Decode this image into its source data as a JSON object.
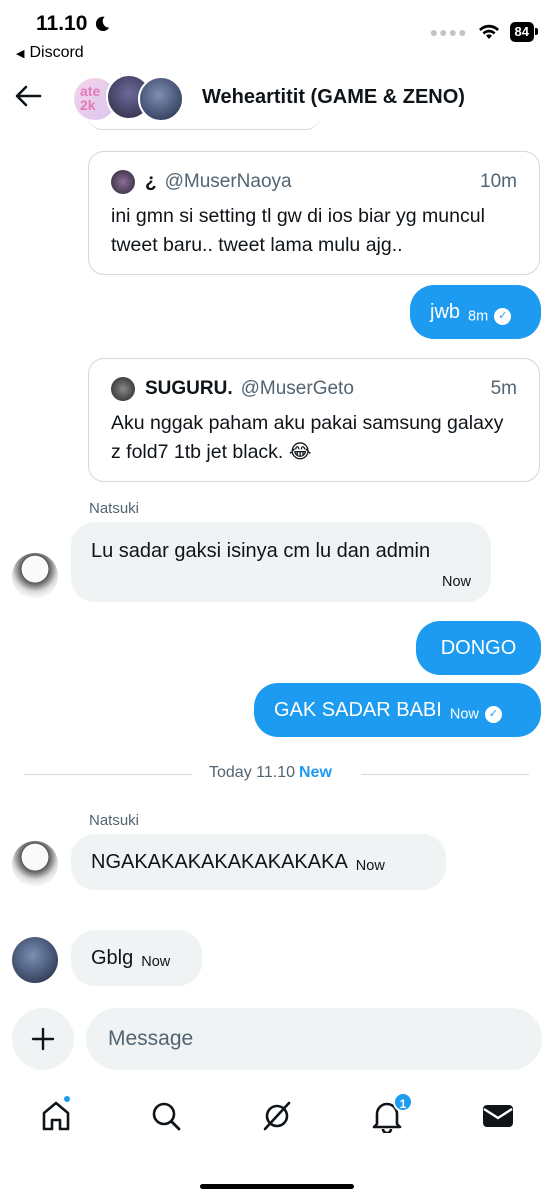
{
  "status_bar": {
    "time": "11.10",
    "back_app": "Discord",
    "battery": "84"
  },
  "header": {
    "title": "Weheartitit (GAME & ZENO)"
  },
  "messages": {
    "quote1": {
      "name": "¿",
      "handle": "@MuserNaoya",
      "time": "10m",
      "text": "ini gmn si setting tl gw di ios biar yg muncul tweet baru.. tweet lama mulu ajg.."
    },
    "out1": {
      "text": "jwb",
      "time": "8m"
    },
    "quote2": {
      "name": "SUGURU.",
      "handle": "@MuserGeto",
      "time": "5m",
      "text": "Aku nggak paham aku pakai samsung galaxy z fold7 1tb jet black. 😂"
    },
    "in1": {
      "sender": "Natsuki",
      "text": "Lu sadar gaksi isinya cm lu dan admin",
      "time": "Now"
    },
    "out2": {
      "text": "DONGO"
    },
    "out3": {
      "text": "GAK SADAR BABI",
      "time": "Now"
    },
    "divider": {
      "label": "Today 11.10",
      "new": "New"
    },
    "in2": {
      "sender": "Natsuki",
      "text": "NGAKAKAKAKAKAKAKAKA",
      "time": "Now"
    },
    "in3": {
      "text": "Gblg",
      "time": "Now"
    }
  },
  "composer": {
    "placeholder": "Message"
  },
  "tabs": {
    "notifications_badge": "1"
  },
  "colors": {
    "accent": "#1d9bf0",
    "bubble_in": "#eff3f4",
    "text_secondary": "#536471"
  }
}
